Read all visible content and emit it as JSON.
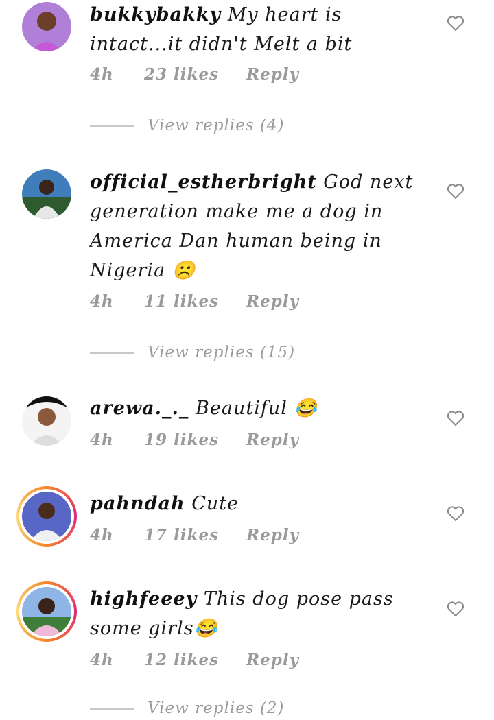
{
  "comments": [
    {
      "username": "bukkybakky",
      "text": "My heart is intact...it didn't Melt a bit",
      "time": "4h",
      "likes": "23 likes",
      "reply": "Reply",
      "view_replies": "View replies (4)"
    },
    {
      "username": "official_estherbright",
      "text": "God next generation make me a dog in America Dan human being in Nigeria ☹️",
      "time": "4h",
      "likes": "11 likes",
      "reply": "Reply",
      "view_replies": "View replies (15)"
    },
    {
      "username": "arewa._._",
      "text": "Beautiful 😂",
      "time": "4h",
      "likes": "19 likes",
      "reply": "Reply"
    },
    {
      "username": "pahndah",
      "text": "Cute",
      "time": "4h",
      "likes": "17 likes",
      "reply": "Reply"
    },
    {
      "username": "highfeeey",
      "text": "This dog pose pass some girls😂",
      "time": "4h",
      "likes": "12 likes",
      "reply": "Reply",
      "view_replies": "View replies (2)"
    }
  ],
  "colors": {
    "meta": "#9a9a9a",
    "story_ring": "#dd2a7b"
  }
}
